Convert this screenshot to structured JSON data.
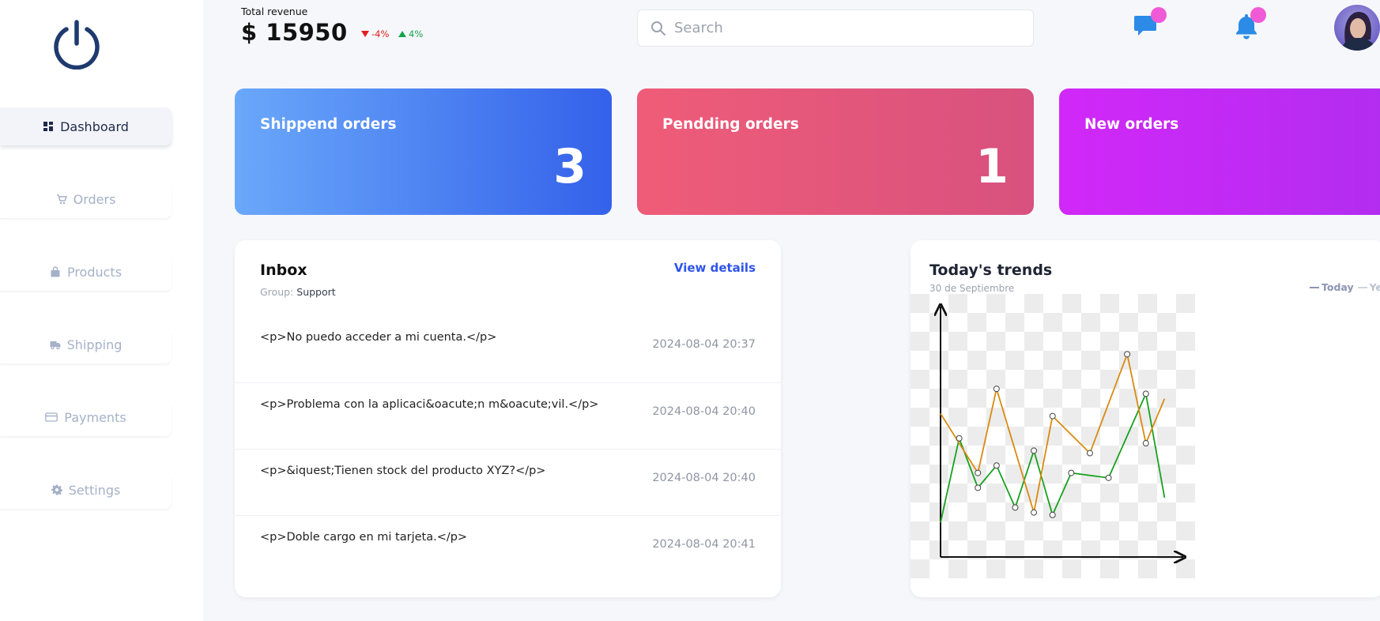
{
  "sidebar": {
    "items": [
      {
        "label": "Dashboard",
        "icon": "dashboard-icon",
        "active": true
      },
      {
        "label": "Orders",
        "icon": "cart-icon",
        "active": false
      },
      {
        "label": "Products",
        "icon": "bag-icon",
        "active": false
      },
      {
        "label": "Shipping",
        "icon": "truck-icon",
        "active": false
      },
      {
        "label": "Payments",
        "icon": "card-icon",
        "active": false
      },
      {
        "label": "Settings",
        "icon": "gear-icon",
        "active": false
      }
    ]
  },
  "header": {
    "revenue_label": "Total revenue",
    "revenue_value": "$ 15950",
    "delta_down": "-4%",
    "delta_up": "4%",
    "search_placeholder": "Search"
  },
  "stats": {
    "shipped": {
      "title": "Shippend orders",
      "count": "3"
    },
    "pending": {
      "title": "Pendding orders",
      "count": "1"
    },
    "new": {
      "title": "New orders",
      "count": ""
    }
  },
  "inbox": {
    "title": "Inbox",
    "group_label": "Group:",
    "group_value": "Support",
    "view_details": "View details",
    "messages": [
      {
        "text": "<p>No puedo acceder a mi cuenta.</p>",
        "time": "2024-08-04 20:37"
      },
      {
        "text": "<p>Problema con la aplicaci&oacute;n m&oacute;vil.</p>",
        "time": "2024-08-04 20:40"
      },
      {
        "text": "<p>&iquest;Tienen stock del producto XYZ?</p>",
        "time": "2024-08-04 20:40"
      },
      {
        "text": "<p>Doble cargo en mi tarjeta.</p>",
        "time": "2024-08-04 20:41"
      }
    ]
  },
  "trends": {
    "title": "Today's trends",
    "subtitle": "30 de Septiembre",
    "legend_today": "Today",
    "legend_yesterday": "Yes"
  },
  "colors": {
    "today_series": "#17a11f",
    "yesterday_series": "#d98a12",
    "accent": "#2f54eb",
    "badge": "#f05ad6"
  },
  "chart_data": {
    "type": "line",
    "title": "Today's trends",
    "subtitle": "30 de Septiembre",
    "x": [
      0,
      1,
      2,
      3,
      4,
      5,
      6,
      7,
      8,
      9,
      10,
      11,
      12,
      13
    ],
    "ylim": [
      0,
      100
    ],
    "grid": false,
    "legend": "top-right",
    "series": [
      {
        "name": "Today",
        "color": "#17a11f",
        "values": [
          14,
          48,
          28,
          37,
          20,
          43,
          17,
          34,
          32,
          66,
          24
        ]
      },
      {
        "name": "Yesterday",
        "color": "#d98a12",
        "values": [
          58,
          34,
          68,
          18,
          57,
          42,
          82,
          46,
          64
        ]
      }
    ]
  }
}
